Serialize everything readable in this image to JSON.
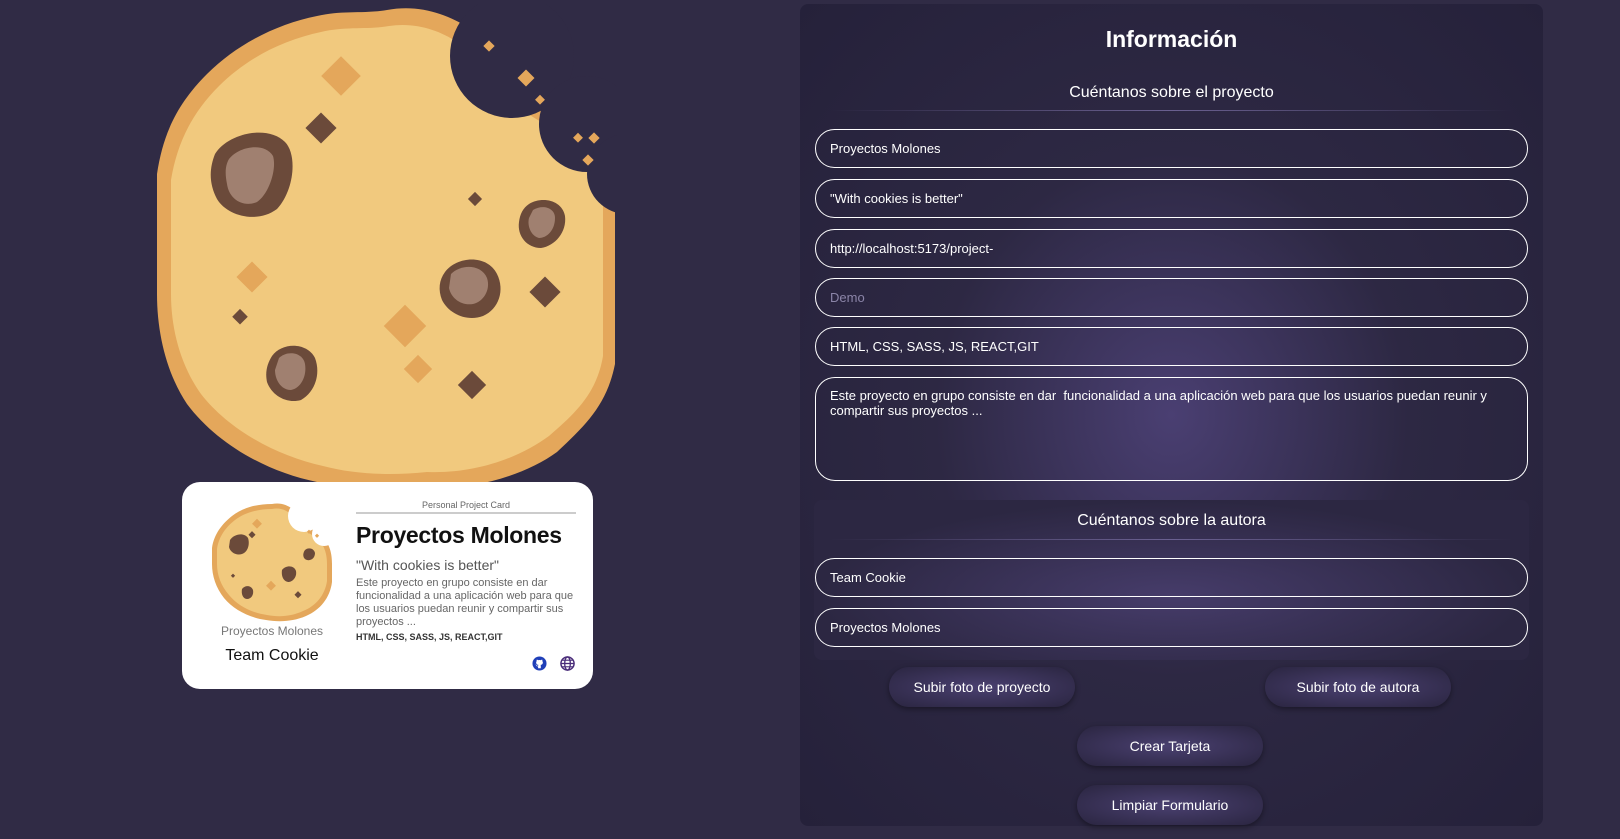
{
  "card": {
    "subtitle": "Personal Project Card",
    "title": "Proyectos Molones",
    "slogan": "\"With cookies is better\"",
    "description": "Este proyecto en grupo consiste en dar funcionalidad a una aplicación web para que los usuarios puedan reunir y compartir sus proyectos ...",
    "technologies": "HTML, CSS, SASS, JS, REACT,GIT",
    "project_small": "Proyectos Molones",
    "author": "Team Cookie",
    "icons": [
      "github-icon",
      "globe-icon"
    ]
  },
  "form": {
    "title": "Información",
    "project_section": "Cuéntanos sobre el proyecto",
    "author_section": "Cuéntanos sobre la autora",
    "fields": {
      "name": "Proyectos Molones",
      "slogan": "\"With cookies is better\"",
      "repo": "http://localhost:5173/project-",
      "demo": "",
      "demo_placeholder": "Demo",
      "technologies": "HTML, CSS, SASS, JS, REACT,GIT",
      "description": "Este proyecto en grupo consiste en dar  funcionalidad a una aplicación web para que los usuarios puedan reunir y compartir sus proyectos ...",
      "author": "Team Cookie",
      "job": "Proyectos Molones"
    },
    "buttons": {
      "upload_project": "Subir foto de proyecto",
      "upload_author": "Subir foto de autora",
      "create": "Crear Tarjeta",
      "clear": "Limpiar Formulario"
    }
  },
  "colors": {
    "background": "#302b45",
    "cookie": "#f1c97e",
    "cookie_edge": "#e4a75b",
    "chocolate": "#6b4a3a"
  }
}
